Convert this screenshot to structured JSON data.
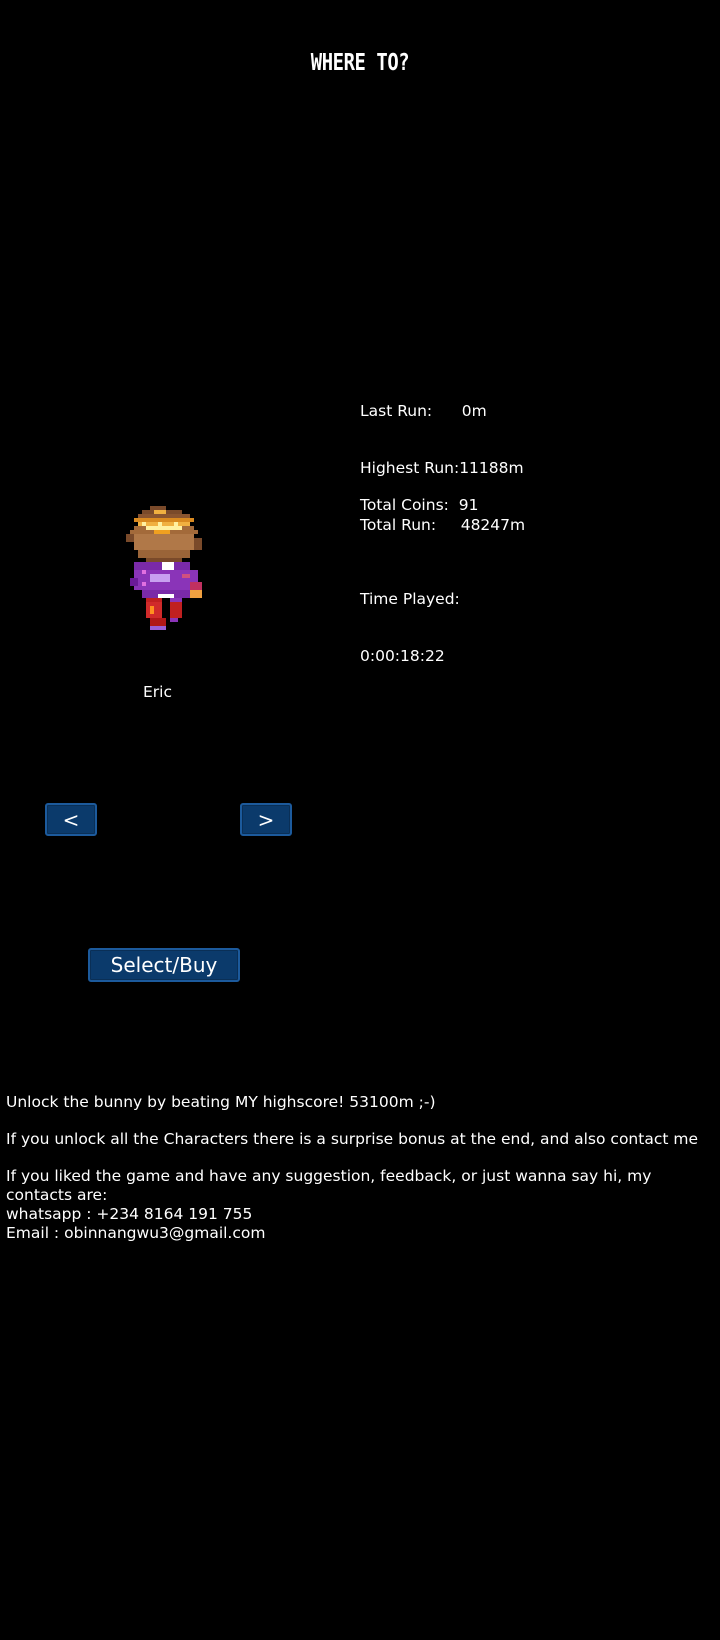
{
  "screen": {
    "title": "WHERE TO?"
  },
  "character": {
    "name": "Eric",
    "sprite": "pixel-boy-character-icon"
  },
  "stats": {
    "last_run_label": "Last Run:",
    "last_run_value": "      0m",
    "highest_run_label": "Highest Run:",
    "highest_run_value": "11188m",
    "total_run_label": "Total Run:",
    "total_run_value": "     48247m",
    "total_coins_label": "Total Coins:",
    "total_coins_value": "  91",
    "time_played_label": "Time Played:",
    "time_played_value": "0:00:18:22"
  },
  "buttons": {
    "prev_label": "<",
    "next_label": ">",
    "select_label": "Select/Buy"
  },
  "info": {
    "unlock_bunny": "Unlock the bunny by beating MY highscore! 53100m ;-)",
    "unlock_all": "If you unlock all the Characters there is a surprise bonus at the end, and also contact me",
    "feedback": "If you liked the game and have any suggestion, feedback, or just wanna say hi, my contacts are:",
    "whatsapp": "whatsapp : +234 8164 191 755",
    "email": "Email : obinnangwu3@gmail.com"
  },
  "colors": {
    "background": "#000000",
    "text": "#ffffff",
    "button_fill": "#0b3a6b",
    "button_border": "#1c5a9c"
  }
}
